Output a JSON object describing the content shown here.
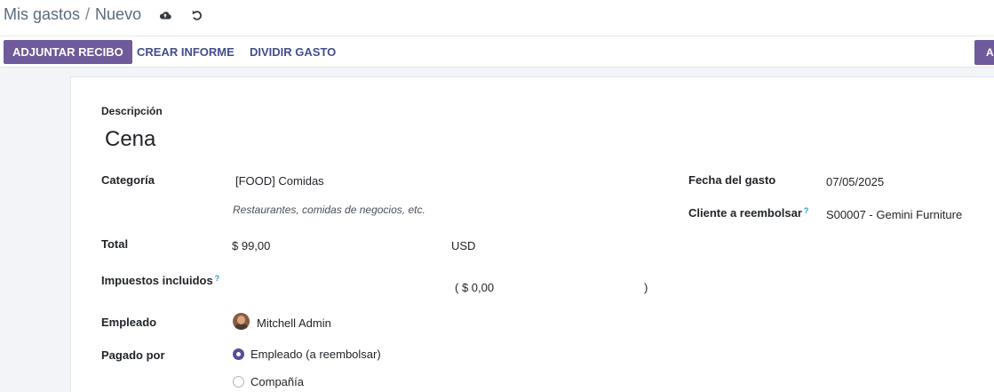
{
  "breadcrumb": {
    "parent": "Mis gastos",
    "separator": "/",
    "current": "Nuevo"
  },
  "icons": {
    "save": "cloud-upload-icon",
    "discard": "undo-icon"
  },
  "actions": {
    "attach_receipt": "ADJUNTAR RECIBO",
    "create_report": "CREAR INFORME",
    "split_expense": "DIVIDIR GASTO",
    "right_button": "A"
  },
  "form": {
    "description_label": "Descripción",
    "description_value": "Cena",
    "category_label": "Categoría",
    "category_value": "[FOOD] Comidas",
    "category_note": "Restaurantes, comidas de negocios, etc.",
    "total_label": "Total",
    "total_value": "$ 99,00",
    "currency": "USD",
    "taxes_label": "Impuestos incluidos",
    "taxes_help": "?",
    "taxes_open": "( $ 0,00",
    "taxes_close": ")",
    "employee_label": "Empleado",
    "employee_value": "Mitchell Admin",
    "paid_by_label": "Pagado por",
    "paid_by_options": [
      {
        "label": "Empleado (a reembolsar)",
        "selected": true
      },
      {
        "label": "Compañía",
        "selected": false
      }
    ],
    "expense_date_label": "Fecha del gasto",
    "expense_date_value": "07/05/2025",
    "customer_label": "Cliente a reembolsar",
    "customer_help": "?",
    "customer_value": "S00007 - Gemini Furniture"
  },
  "colors": {
    "primary": "#6f5a9b",
    "link": "#434d8f",
    "help": "#2e9ccc"
  }
}
